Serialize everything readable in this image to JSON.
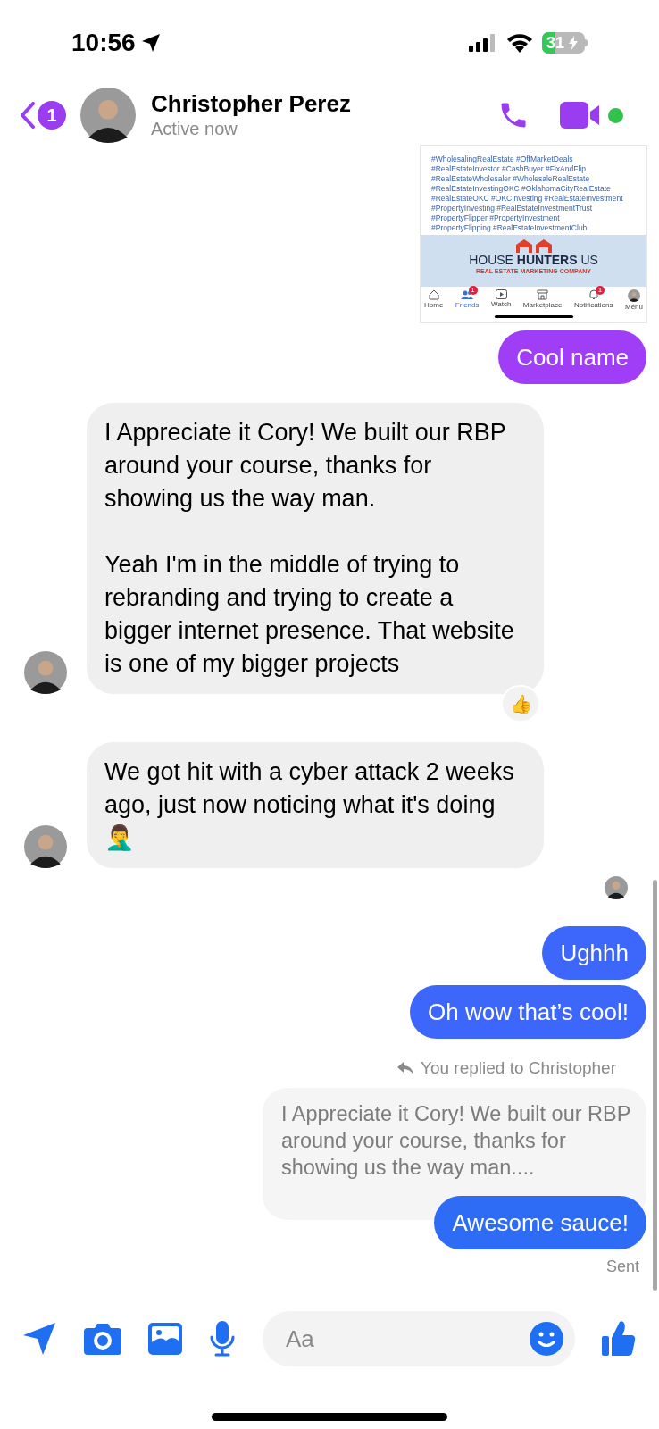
{
  "status_bar": {
    "time": "10:56",
    "battery": "31"
  },
  "header": {
    "back_badge": "1",
    "name": "Christopher Perez",
    "status": "Active now",
    "online": true
  },
  "messages": [
    {
      "kind": "shared_image",
      "hashtags": [
        "#WholesalingRealEstate #OffMarketDeals",
        "#RealEstateInvestor #CashBuyer #FixAndFlip",
        "#RealEstateWholesaler #WholesaleRealEstate",
        "#RealEstateInvestingOKC #OklahomaCityRealEstate",
        "#RealEstateOKC #OKCInvesting #RealEstateInvestment",
        "#PropertyInvesting #RealEstateInvestmentTrust",
        "#PropertyFlipper #PropertyInvestment",
        "#PropertyFlipping #RealEstateInvestmentClub"
      ],
      "logo": "HOUSE **HUNTERS** US",
      "tagline": "REAL ESTATE MARKETING COMPANY",
      "nav": [
        {
          "label": "Home",
          "selected": false
        },
        {
          "label": "Friends",
          "badge": "1",
          "selected": true
        },
        {
          "label": "Watch",
          "selected": false
        },
        {
          "label": "Marketplace",
          "selected": false
        },
        {
          "label": "Notifications",
          "badge": "1",
          "selected": false
        },
        {
          "label": "Menu",
          "selected": false
        }
      ]
    },
    {
      "kind": "outgoing",
      "text": "Cool name",
      "color": "#a03ef7"
    },
    {
      "kind": "incoming",
      "text": "I Appreciate it Cory! We built our RBP around your course, thanks for showing us the way man.\n\nYeah I'm in the middle of trying to rebranding and trying to create a bigger internet presence. That website is one of my bigger projects",
      "avatar": true,
      "reaction": "👍"
    },
    {
      "kind": "incoming",
      "text": "We got hit with a cyber attack 2 weeks ago, just now noticing what it's doing 🤦‍♂️",
      "avatar": true
    },
    {
      "kind": "read_receipt"
    },
    {
      "kind": "outgoing",
      "text": "Ughhh",
      "color": "#3d66fb"
    },
    {
      "kind": "outgoing",
      "text": "Oh wow that’s cool!",
      "color": "#3d66fb"
    },
    {
      "kind": "reply_label",
      "text": "You replied to Christopher"
    },
    {
      "kind": "quoted",
      "text": "I Appreciate it Cory! We built our RBP around your course, thanks for showing us the way man...."
    },
    {
      "kind": "outgoing",
      "text": "Awesome sauce!",
      "color": "#2f6cf6"
    },
    {
      "kind": "status",
      "text": "Sent"
    }
  ],
  "composer": {
    "placeholder": "Aa"
  }
}
